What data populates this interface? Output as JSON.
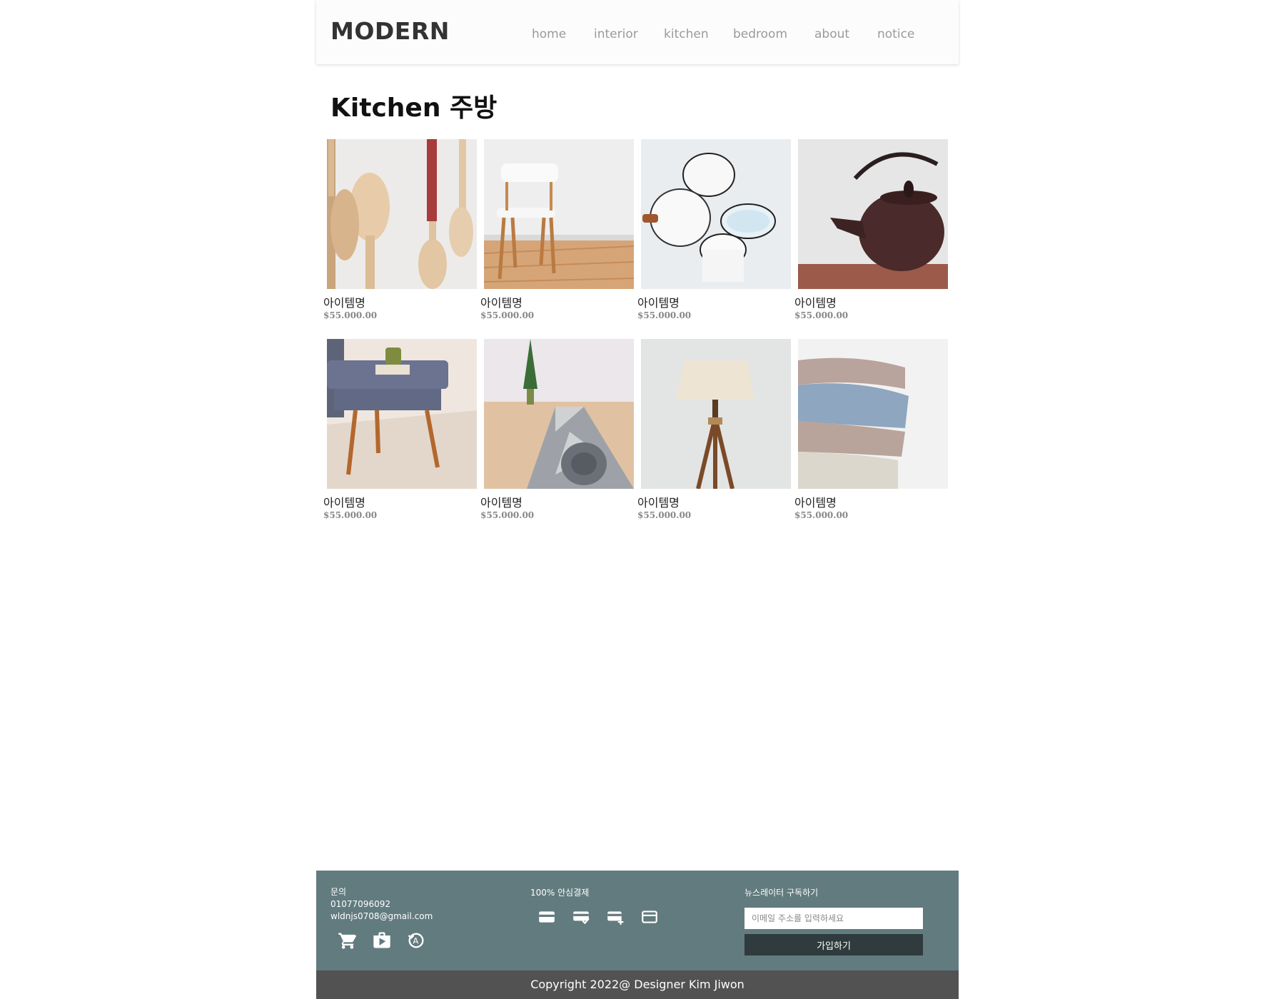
{
  "header": {
    "logo": "MODERN",
    "nav": [
      "home",
      "interior",
      "kitchen",
      "bedroom",
      "about",
      "notice"
    ]
  },
  "main": {
    "title": "Kitchen 주방",
    "items": [
      {
        "name": "아이템명",
        "price": "$55.000.00",
        "image": "wooden-spoons"
      },
      {
        "name": "아이템명",
        "price": "$55.000.00",
        "image": "white-chair"
      },
      {
        "name": "아이템명",
        "price": "$55.000.00",
        "image": "enamel-kettles"
      },
      {
        "name": "아이템명",
        "price": "$55.000.00",
        "image": "cast-iron-teapot"
      },
      {
        "name": "아이템명",
        "price": "$55.000.00",
        "image": "grey-chair"
      },
      {
        "name": "아이템명",
        "price": "$55.000.00",
        "image": "rolled-rug"
      },
      {
        "name": "아이템명",
        "price": "$55.000.00",
        "image": "tripod-lamp"
      },
      {
        "name": "아이템명",
        "price": "$55.000.00",
        "image": "knit-blankets"
      }
    ]
  },
  "footer": {
    "contact": {
      "label": "문의",
      "phone": "01077096092",
      "email": "wldnjs0708@gmail.com",
      "icons": [
        "cart-icon",
        "shopping-bag-play-icon",
        "currency-exchange-icon"
      ]
    },
    "payment": {
      "title": "100% 안심결제",
      "icons": [
        "credit-card-icon",
        "card-check-icon",
        "card-add-icon",
        "card-outline-icon"
      ]
    },
    "newsletter": {
      "title": "뉴스레이터 구독하기",
      "placeholder": "이메일 주소를 입력하세요",
      "button": "가입하기"
    }
  },
  "copyright": "Copyright 2022@ Designer Kim Jiwon"
}
